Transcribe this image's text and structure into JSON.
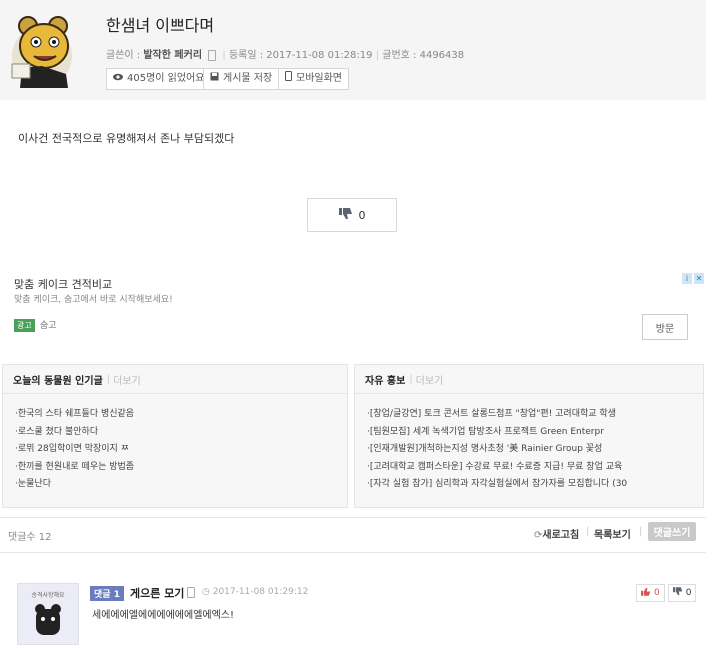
{
  "post": {
    "title": "한샘녀 이쁘다며",
    "author_label": "글쓴이 :",
    "author": "발작한 페커리",
    "date_label": "등록일 : 2017-11-08 01:28:19",
    "number_label": "글번호 : 4496438",
    "views": "405명이 읽었어요",
    "save": "게시물 저장",
    "mobile": "모바일화면",
    "body": "이사건 전국적으로 유명해져서 존나 부담되겠다",
    "vote_count": "0"
  },
  "ad": {
    "title": "맞춤 케이크 견적비교",
    "subtitle": "맞춤 케이크, 숨고에서 바로 시작해보세요!",
    "badge": "광고",
    "advertiser": "숨고",
    "button": "방문"
  },
  "popular": {
    "title": "오늘의 동물원 인기글",
    "more": "더보기",
    "items": [
      "·한국의 스타 쉐프들다 병신같음",
      "·로스쿨 쳤다 불안하다",
      "·로뮈 28입학이면 막장이지 ㅉ",
      "·한끼를 현원내로 떼우는 방법좀",
      "·눈물난다"
    ]
  },
  "promo": {
    "title": "자유 홍보",
    "more": "더보기",
    "items": [
      "·[창업/글강연] 토크 콘서트 살롱드첨프 \"창업\"편! 고려대학교 학생",
      "·[팀원모집] 세계 녹색기업 탐방조사 프로젝트 Green Enterpr",
      "·[인재개발원]개척하는지성 명사초청 '美 Rainier Group 꽃성",
      "·[고려대학교 캠퍼스타운] 수강료 무료! 수료증 지급! 무료 창업 교육",
      "·[자각 실험 참가] 심리학과 자각실험실에서 참가자를 모집합니다 (30"
    ]
  },
  "comments_bar": {
    "count": "댓글수 12",
    "refresh": "새로고침",
    "list": "목록보기",
    "write": "댓글쓰기"
  },
  "comment": {
    "avatar_caption": "승격사항해요",
    "badge": "댓글 1",
    "author": "게으른 모기",
    "date": "2017-11-08 01:29:12",
    "text": "세에에에엘에에에에에에엘에엑스!",
    "up": "0",
    "down": "0"
  }
}
